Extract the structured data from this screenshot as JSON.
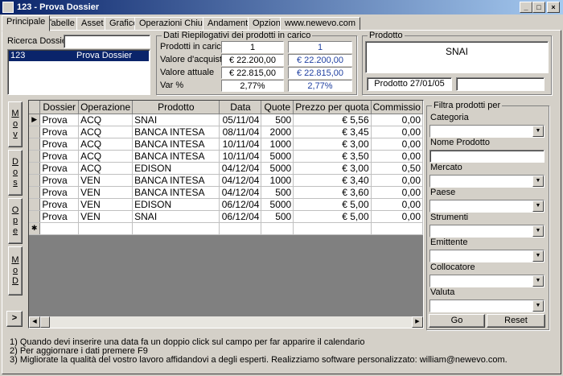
{
  "window": {
    "title": "123 - Prova Dossier"
  },
  "tabs": [
    "Principale",
    "Tabelle",
    "Asset",
    "Grafico",
    "Operazioni Chiuse",
    "Andamento",
    "Opzioni",
    "www.newevo.com"
  ],
  "search": {
    "label": "Ricerca Dossier",
    "value": ""
  },
  "dossier_list": [
    {
      "id": "123",
      "name": "Prova Dossier"
    }
  ],
  "summary": {
    "title": "Dati Riepilogativi dei prodotti in carico",
    "rows": [
      {
        "label": "Prodotti in carico",
        "v1": "1",
        "v2": "1"
      },
      {
        "label": "Valore d'acquisto",
        "v1": "€ 22.200,00",
        "v2": "€ 22.200,00"
      },
      {
        "label": "Valore attuale",
        "v1": "€ 22.815,00",
        "v2": "€ 22.815,00"
      },
      {
        "label": "Var %",
        "v1": "2,77%",
        "v2": "2,77%"
      }
    ]
  },
  "product": {
    "title": "Prodotto",
    "name": "SNAI",
    "date_label": "Prodotto 27/01/05",
    "extra": ""
  },
  "side_buttons": [
    "Mov",
    "Dos",
    "Ope",
    "MoD"
  ],
  "next_button": ">",
  "grid": {
    "columns": [
      "Dossier",
      "Operazione",
      "Prodotto",
      "Data",
      "Quote",
      "Prezzo per quota",
      "Commissio"
    ],
    "rows": [
      [
        "Prova",
        "ACQ",
        "SNAI",
        "05/11/04",
        "500",
        "€ 5,56",
        "0,00"
      ],
      [
        "Prova",
        "ACQ",
        "BANCA INTESA",
        "08/11/04",
        "2000",
        "€ 3,45",
        "0,00"
      ],
      [
        "Prova",
        "ACQ",
        "BANCA INTESA",
        "10/11/04",
        "1000",
        "€ 3,00",
        "0,00"
      ],
      [
        "Prova",
        "ACQ",
        "BANCA INTESA",
        "10/11/04",
        "5000",
        "€ 3,50",
        "0,00"
      ],
      [
        "Prova",
        "ACQ",
        "EDISON",
        "04/12/04",
        "5000",
        "€ 3,00",
        "0,50"
      ],
      [
        "Prova",
        "VEN",
        "BANCA INTESA",
        "04/12/04",
        "1000",
        "€ 3,40",
        "0,00"
      ],
      [
        "Prova",
        "VEN",
        "BANCA INTESA",
        "04/12/04",
        "500",
        "€ 3,60",
        "0,00"
      ],
      [
        "Prova",
        "VEN",
        "EDISON",
        "06/12/04",
        "5000",
        "€ 5,00",
        "0,00"
      ],
      [
        "Prova",
        "VEN",
        "SNAI",
        "06/12/04",
        "500",
        "€ 5,00",
        "0,00"
      ]
    ],
    "current_marker": "▶",
    "new_marker": "✱"
  },
  "filter": {
    "title": "Filtra prodotti per",
    "fields": [
      {
        "label": "Categoria",
        "kind": "combo",
        "value": ""
      },
      {
        "label": "Nome Prodotto",
        "kind": "text",
        "value": ""
      },
      {
        "label": "Mercato",
        "kind": "combo",
        "value": ""
      },
      {
        "label": "Paese",
        "kind": "combo",
        "value": ""
      },
      {
        "label": "Strumenti",
        "kind": "combo",
        "value": ""
      },
      {
        "label": "Emittente",
        "kind": "combo",
        "value": ""
      },
      {
        "label": "Collocatore",
        "kind": "combo",
        "value": ""
      },
      {
        "label": "Valuta",
        "kind": "combo",
        "value": ""
      }
    ],
    "go_label": "Go",
    "reset_label": "Reset"
  },
  "notes": [
    "1) Quando devi inserire una data fa un doppio click sul campo per far apparire il calendario",
    "2) Per aggiornare i dati premere F9",
    "3) Migliorate la qualità del vostro lavoro affidandovi a degli esperti. Realizziamo software personalizzato: william@newevo.com."
  ]
}
